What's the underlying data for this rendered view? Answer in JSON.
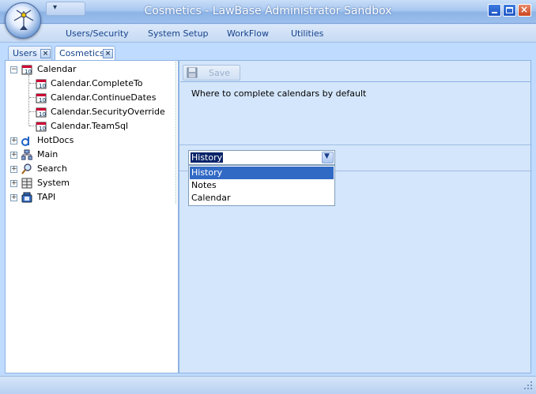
{
  "window": {
    "title": "Cosmetics - LawBase Administrator Sandbox"
  },
  "qat": {
    "glyph": "▾"
  },
  "menu": [
    "Users/Security",
    "System Setup",
    "WorkFlow",
    "Utilities"
  ],
  "tabs": [
    {
      "label": "Users"
    },
    {
      "label": "Cosmetics"
    }
  ],
  "tree": {
    "calendar": {
      "label": "Calendar",
      "children": [
        "Calendar.CompleteTo",
        "Calendar.ContinueDates",
        "Calendar.SecurityOverride",
        "Calendar.TeamSql"
      ]
    },
    "hotdocs": "HotDocs",
    "main": "Main",
    "search": "Search",
    "system": "System",
    "tapi": "TAPI"
  },
  "toolbar": {
    "save_label": "Save"
  },
  "detail": {
    "description": "Where to complete calendars by default",
    "selected": "History",
    "options": [
      "History",
      "Notes",
      "Calendar"
    ]
  },
  "colors": {
    "accent": "#316ac5",
    "frame": "#bfdbff"
  }
}
